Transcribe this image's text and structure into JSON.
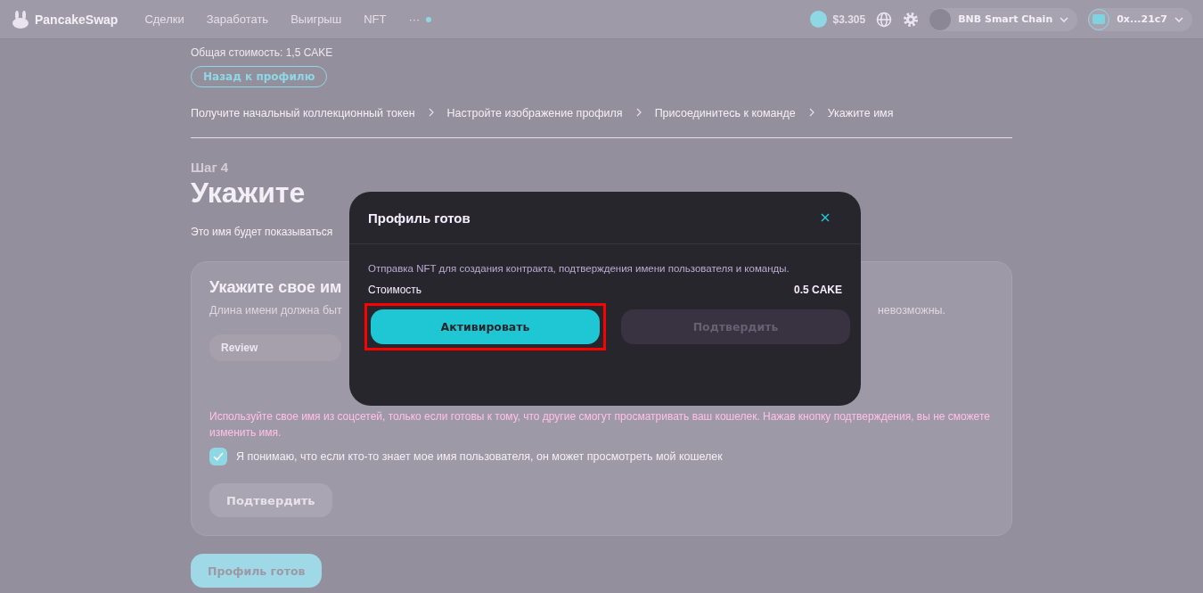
{
  "header": {
    "logo": "PancakeSwap",
    "nav": [
      {
        "label": "Сделки"
      },
      {
        "label": "Заработать"
      },
      {
        "label": "Выигрыш"
      },
      {
        "label": "NFT"
      },
      {
        "label": "···"
      }
    ],
    "cake_price": "$3.305",
    "network": "BNB Smart Chain",
    "wallet": "0x...21c7"
  },
  "total_cost": "Общая стоимость: 1,5 CAKE",
  "back_button": "Назад к профилю",
  "steps": [
    {
      "label": "Получите начальный коллекционный токен"
    },
    {
      "label": "Настройте изображение профиля"
    },
    {
      "label": "Присоединитесь к команде"
    },
    {
      "label": "Укажите имя"
    }
  ],
  "step_label": "Шаг 4",
  "heading": "Укажите",
  "intro": "Это имя будет показываться",
  "card": {
    "title": "Укажите свое им",
    "description_start": "Длина имени должна быт",
    "description_end": "невозможны.",
    "name_value": "Review",
    "warning": "Используйте свое имя из соцсетей, только если готовы к тому, что другие смогут просматривать ваш кошелек. Нажав кнопку подтверждения, вы не сможете изменить имя.",
    "consent": {
      "label": "Я понимаю, что если кто-то знает мое имя пользователя, он может просмотреть мой кошелек",
      "checked": true
    },
    "confirm_button": {
      "label": "Подтвердить",
      "disabled": true
    }
  },
  "finish_button": "Профиль готов",
  "modal": {
    "title": "Профиль готов",
    "text": "Отправка NFT для создания контракта, подтверждения имени пользователя и команды.",
    "cost_label": "Стоимость",
    "cost_value": "0.5 CAKE",
    "buttons": [
      {
        "label": "Активировать",
        "disabled": false,
        "highlighted": true
      },
      {
        "label": "Подтвердить",
        "disabled": true,
        "highlighted": false
      }
    ]
  }
}
